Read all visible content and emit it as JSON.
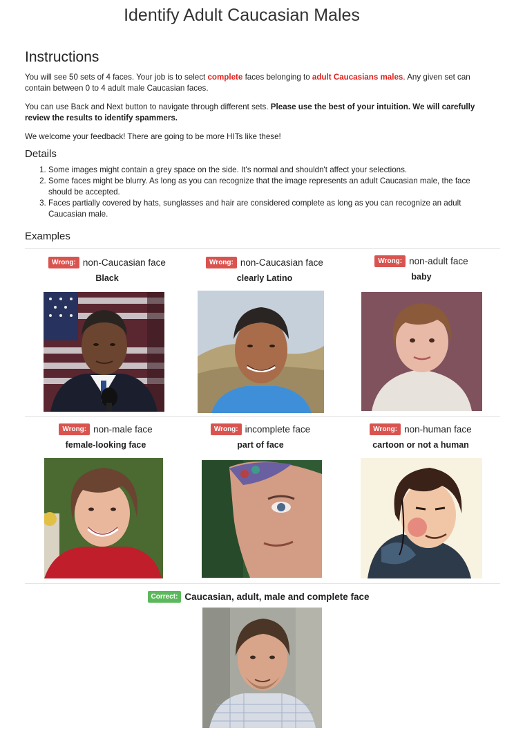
{
  "title": "Identify Adult Caucasian Males",
  "instructions": {
    "heading": "Instructions",
    "p1_a": "You will see 50 sets of 4 faces. Your job is to select ",
    "p1_b": "complete",
    "p1_c": " faces belonging to ",
    "p1_d": "adult Caucasians males",
    "p1_e": ". Any given set can contain between 0 to 4 adult male Caucasian faces.",
    "p2_a": "You can use Back and Next button to navigate through different sets. ",
    "p2_b": "Please use the best of your intuition. We will carefully review the results to identify spammers.",
    "p3": "We welcome your feedback! There are going to be more HITs like these!"
  },
  "details": {
    "heading": "Details",
    "items": [
      "Some images might contain a grey space on the side. It's normal and shouldn't affect your selections.",
      "Some faces might be blurry. As long as you can recognize that the image represents an adult Caucasian male, the face should be accepted.",
      "Faces partially covered by hats, sunglasses and hair are considered complete as long as you can recognize an adult Caucasian male."
    ]
  },
  "examples": {
    "heading": "Examples",
    "wrong_tag": "Wrong:",
    "correct_tag": "Correct:",
    "items": [
      {
        "reason": "non-Caucasian face",
        "label": "Black"
      },
      {
        "reason": "non-Caucasian face",
        "label": "clearly Latino"
      },
      {
        "reason": "non-adult face",
        "label": "baby"
      },
      {
        "reason": "non-male face",
        "label": "female-looking face"
      },
      {
        "reason": "incomplete face",
        "label": "part of face"
      },
      {
        "reason": "non-human face",
        "label": "cartoon or not a human"
      }
    ],
    "correct": {
      "reason": "Caucasian, adult, male and complete face"
    }
  },
  "colors": {
    "red": "#e0201c",
    "wrong_badge": "#d9534f",
    "correct_badge": "#5cb85c"
  }
}
